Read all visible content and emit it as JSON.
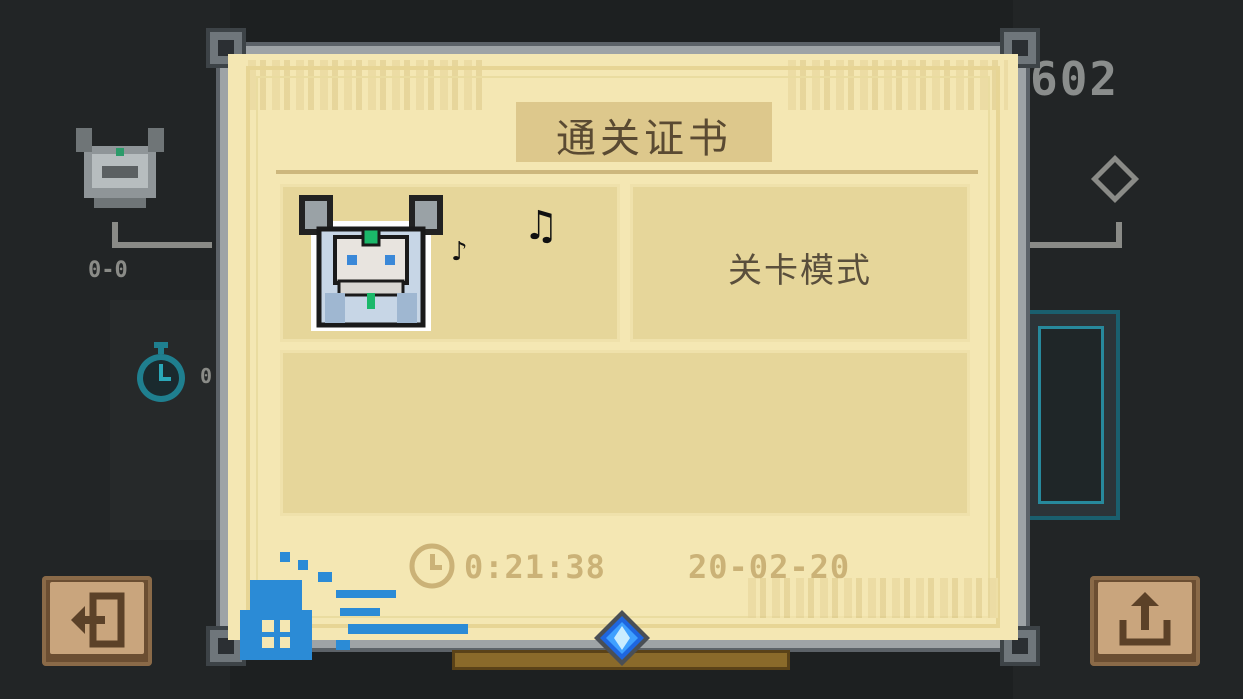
{
  "hud": {
    "score": "602",
    "key_counter": "0-0",
    "timer_value": "0"
  },
  "certificate": {
    "title": "通关证书",
    "mode": "关卡模式",
    "clear_time": "0:21:38",
    "date": "20-02-20"
  },
  "icons": {
    "exit": "exit-icon",
    "share": "share-icon",
    "clock": "clock-icon",
    "gem": "gem-icon",
    "stopwatch": "stopwatch-icon"
  },
  "colors": {
    "paper": "#f4e7b3",
    "box": "#e6d69a",
    "button": "#c9a57d",
    "stamp": "#2b8bd6",
    "gem": "#1e66e0"
  }
}
